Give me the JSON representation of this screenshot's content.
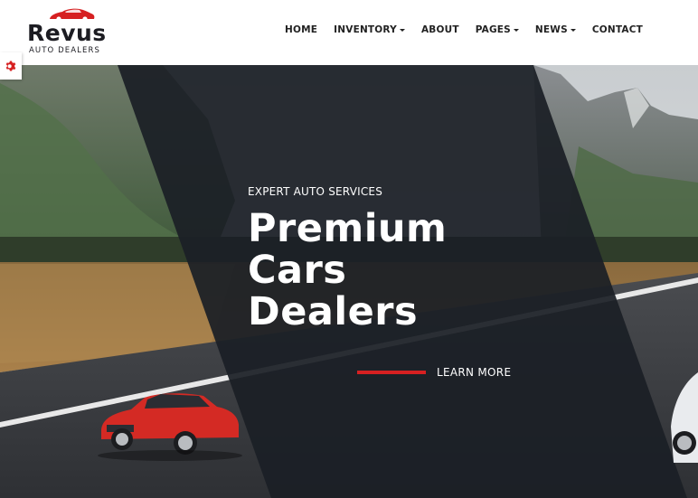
{
  "brand": {
    "name": "Revus",
    "tagline": "AUTO DEALERS",
    "accent": "#d62021",
    "dark": "#1c1c22"
  },
  "nav": {
    "items": [
      {
        "label": "HOME",
        "dropdown": false
      },
      {
        "label": "INVENTORY",
        "dropdown": true
      },
      {
        "label": "ABOUT",
        "dropdown": false
      },
      {
        "label": "PAGES",
        "dropdown": true
      },
      {
        "label": "NEWS",
        "dropdown": true
      },
      {
        "label": "CONTACT",
        "dropdown": false
      }
    ]
  },
  "settings": {
    "icon": "gear-icon",
    "color": "#d62021"
  },
  "hero": {
    "eyebrow": "EXPERT AUTO SERVICES",
    "headline_line1": "Premium",
    "headline_line2": "Cars",
    "headline_line3": "Dealers",
    "cta_label": "LEARN MORE"
  }
}
